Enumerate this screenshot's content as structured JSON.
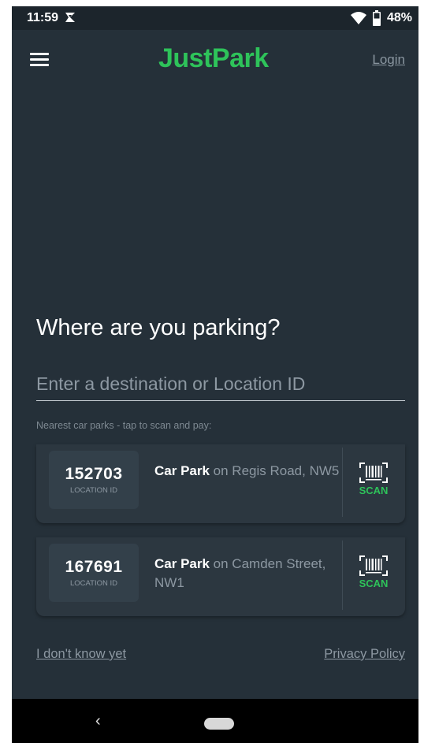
{
  "status_bar": {
    "time": "11:59",
    "battery": "48%",
    "icons": [
      "notification-icon",
      "wifi-icon",
      "battery-icon"
    ]
  },
  "app_bar": {
    "logo": "JustPark",
    "login": "Login",
    "menu_icon": "hamburger-menu-icon"
  },
  "main": {
    "heading": "Where are you parking?",
    "search_placeholder": "Enter a destination or Location ID",
    "search_value": "",
    "nearest_label": "Nearest car parks - tap to scan and pay:"
  },
  "car_parks": [
    {
      "location_id": "152703",
      "location_id_label": "LOCATION ID",
      "type": "Car Park",
      "address": "on Regis Road, NW5",
      "scan_label": "SCAN",
      "scan_icon": "barcode-scan-icon"
    },
    {
      "location_id": "167691",
      "location_id_label": "LOCATION ID",
      "type": "Car Park",
      "address": "on Camden Street, NW1",
      "scan_label": "SCAN",
      "scan_icon": "barcode-scan-icon"
    }
  ],
  "footer": {
    "dont_know": "I don't know yet",
    "privacy": "Privacy Policy"
  },
  "nav_bar": {
    "back_glyph": "‹",
    "back_icon": "back-chevron-icon",
    "home_icon": "home-pill-icon"
  },
  "colors": {
    "background": "#253039",
    "card": "#2c3740",
    "accent_green": "#2ec35a",
    "muted_text": "#8d98a2"
  }
}
